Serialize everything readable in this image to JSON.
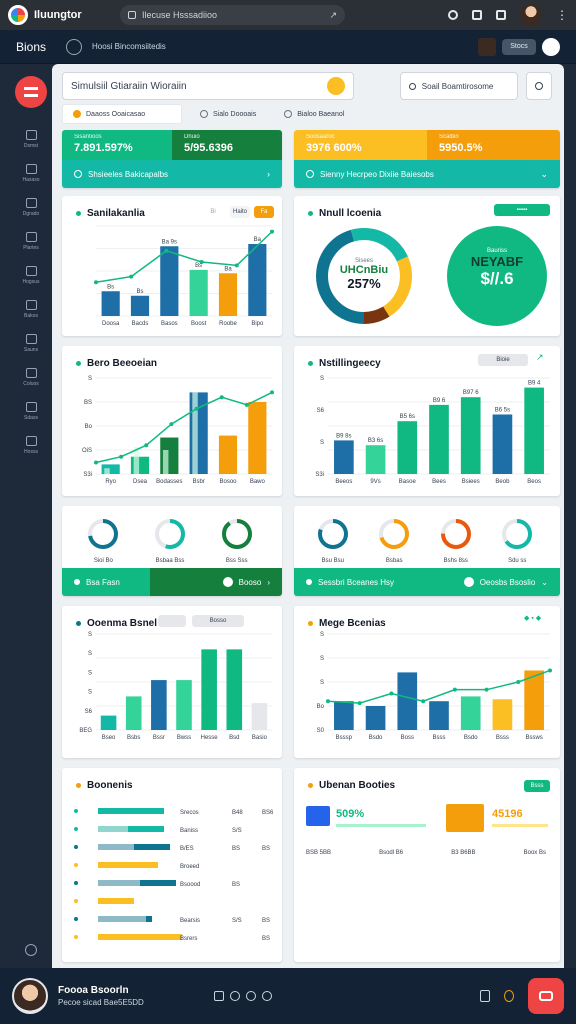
{
  "topbar": {
    "app_title": "Iluungtor",
    "url": "Ilecuse Hsssadiioo"
  },
  "navbar": {
    "title": "Bions",
    "crumb": "Hoosi Bincomsiitedis",
    "pill": "Stocs"
  },
  "sidebar": {
    "items": [
      {
        "label": "Dsmst",
        "icon": "chart-icon"
      },
      {
        "label": "Haxaso",
        "icon": "doc-icon"
      },
      {
        "label": "Dgrado",
        "icon": "folder-icon"
      },
      {
        "label": "Plartes",
        "icon": "calendar-icon"
      },
      {
        "label": "Hogsus",
        "icon": "image-icon"
      },
      {
        "label": "Bakos",
        "icon": "grid-icon"
      },
      {
        "label": "Sauns",
        "icon": "chat-icon"
      },
      {
        "label": "Coluos",
        "icon": "link-icon"
      },
      {
        "label": "Sdass",
        "icon": "globe-icon"
      },
      {
        "label": "Hosss",
        "icon": "settings-icon"
      }
    ]
  },
  "search": {
    "query": "Simulsiil Gtiaraiin Wioraiin",
    "secondary": "Soail Boamtirosome"
  },
  "tabs": [
    "Daaoss Ooaicasao",
    "Sialo Doooais",
    "Bialoo Baeanol"
  ],
  "kpi": [
    {
      "cells": [
        {
          "small": "Sisantioos",
          "big": "7.891.597%",
          "color": "#10b981"
        },
        {
          "small": "Dhuio",
          "big": "5/95.6396",
          "color": "#15803d"
        }
      ],
      "bottom": "Shsieeles Bakicapalbs",
      "bottom_color": "#14b8a6"
    },
    {
      "cells": [
        {
          "small": "Soosaaroc",
          "big": "3976 600%",
          "color": "#fbbf24"
        },
        {
          "small": "Scalbin",
          "big": "5950.5%",
          "color": "#f59e0b"
        }
      ],
      "bottom": "Sienny Hecrpeo Dixiie Baiesobs",
      "bottom_color": "#14b8a6"
    }
  ],
  "card1": {
    "title": "Sanilakanlia",
    "pills": [
      "Bi",
      "Haito",
      "Fa"
    ],
    "chart_data": {
      "type": "bar",
      "categories": [
        "Doosa",
        "Bacds",
        "Basos",
        "Boost",
        "Roobe",
        "Bipo"
      ],
      "values": [
        22,
        18,
        62,
        41,
        38,
        64
      ],
      "line": [
        30,
        35,
        58,
        48,
        45,
        75
      ],
      "ylim": [
        0,
        80
      ],
      "value_labels": [
        "Bs",
        "Bs",
        "Ba 9s",
        "Bs",
        "Ba",
        "Ba"
      ]
    }
  },
  "card2": {
    "title": "Nnull lcoenia",
    "donut": {
      "label": "Sisees",
      "big": "UHCnBiu",
      "sub": "257%"
    },
    "circle": {
      "label": "Bauriss",
      "big": "NEYABF",
      "sub": "$//.6"
    }
  },
  "card3": {
    "title": "Bero Beeoeian",
    "chart_data": {
      "type": "bar",
      "categories": [
        "Ryo",
        "Dsea",
        "Bodasses",
        "Bsbr",
        "Bosoo",
        "Bawo"
      ],
      "values": [
        10,
        18,
        38,
        85,
        40,
        75
      ],
      "values2": [
        6,
        28,
        25,
        85,
        0,
        0
      ],
      "line": [
        12,
        18,
        30,
        52,
        68,
        80,
        72,
        85
      ],
      "ylim": [
        0,
        100
      ],
      "yticks": [
        "S3i",
        "OiS",
        "Bo",
        "BS",
        "S"
      ]
    }
  },
  "card4": {
    "title": "Nstillingeecy",
    "pills": [
      "Bioie"
    ],
    "chart_data": {
      "type": "bar",
      "categories": [
        "Beeos",
        "9Vs",
        "Basoe",
        "Bees",
        "Bsiees",
        "Beob",
        "Beos"
      ],
      "values": [
        35,
        30,
        55,
        72,
        80,
        62,
        90
      ],
      "ylim": [
        0,
        100
      ],
      "yticks": [
        "S3i",
        "S",
        "S6",
        "S"
      ],
      "value_labels": [
        "B9 8s",
        "B3 6s",
        "B5 6s",
        "B9 6",
        "B97 6",
        "B6 5s",
        "B9 4"
      ]
    }
  },
  "gauges1": [
    {
      "value": 0.72,
      "label": "Sioi Bo",
      "color": "#0e7490"
    },
    {
      "value": 0.55,
      "label": "Bsbaa Bss",
      "color": "#14b8a6"
    },
    {
      "value": 0.9,
      "label": "Bss Sss",
      "color": "#15803d"
    }
  ],
  "gauges2": [
    {
      "value": 0.8,
      "label": "Bsu Bsu",
      "color": "#0e7490"
    },
    {
      "value": 0.7,
      "label": "Bsbas",
      "color": "#f59e0b"
    },
    {
      "value": 0.75,
      "label": "Bshs 8ss",
      "color": "#ea580c"
    },
    {
      "value": 0.65,
      "label": "Sdu ss",
      "color": "#14b8a6"
    }
  ],
  "strip1": {
    "left": "Bsa Fasn",
    "right": "Booso"
  },
  "strip2": {
    "left": "Sessbri Bceanes Hsy",
    "right": "Oeosbs Bsoslio"
  },
  "card5": {
    "title": "Ooenma Bsnel",
    "pills": [
      "",
      "Bosso"
    ],
    "chart_data": {
      "type": "bar",
      "categories": [
        "Bseo",
        "Bsbs",
        "Bssr",
        "Bwss",
        "Hesse",
        "Bsd",
        "Basio"
      ],
      "values": [
        15,
        35,
        52,
        52,
        84,
        84,
        28
      ],
      "ylim": [
        0,
        100
      ],
      "yticks": [
        "BEG",
        "S6",
        "S",
        "S",
        "S",
        "S"
      ]
    }
  },
  "card6": {
    "title": "Mege Bcenias",
    "chart_data": {
      "type": "bar",
      "categories": [
        "Bsssp",
        "Bsdo",
        "Boss",
        "Bsss",
        "Bsdo",
        "Bsss",
        "Bssws"
      ],
      "values": [
        30,
        25,
        60,
        30,
        35,
        32,
        62
      ],
      "line": [
        30,
        28,
        38,
        30,
        42,
        42,
        50,
        62
      ],
      "ylim": [
        0,
        100
      ],
      "yticks": [
        "S0",
        "Bo",
        "S",
        "S",
        "S"
      ]
    }
  },
  "card7": {
    "title": "Boonenis",
    "rows": [
      {
        "bar": 0.55,
        "bar2": 0,
        "color": "#14b8a6",
        "text": "Srecos",
        "v1": "B48",
        "v2": "BS6"
      },
      {
        "bar": 0.55,
        "bar2": 0.25,
        "color": "#14b8a6",
        "text": "Baniss",
        "v1": "S/S",
        "v2": ""
      },
      {
        "bar": 0.6,
        "bar2": 0.3,
        "color": "#0e7490",
        "text": "B/ES",
        "v1": "BS",
        "v2": "BS"
      },
      {
        "bar": 0.5,
        "bar2": 0,
        "color": "#fbbf24",
        "text": "Broeed",
        "v1": "",
        "v2": ""
      },
      {
        "bar": 0.65,
        "bar2": 0.35,
        "color": "#0e7490",
        "text": "Bsoood",
        "v1": "BS",
        "v2": ""
      },
      {
        "bar": 0.3,
        "bar2": 0,
        "color": "#fbbf24",
        "text": "",
        "v1": "",
        "v2": ""
      },
      {
        "bar": 0.45,
        "bar2": 0.4,
        "color": "#0e7490",
        "text": "Bearsis",
        "v1": "S/S",
        "v2": "BS"
      },
      {
        "bar": 0.7,
        "bar2": 0,
        "color": "#fbbf24",
        "text": "Bsrers",
        "v1": "",
        "v2": "BS"
      }
    ]
  },
  "card8": {
    "title": "Ubenan Booties",
    "pill": "Bsss",
    "items": [
      {
        "value": "509%",
        "sub": "",
        "color": "#10b981"
      },
      {
        "value": "45196",
        "sub": "",
        "color": "#f59e0b"
      }
    ],
    "footer": [
      "BSB 5BB",
      "Bsodl B6",
      "B3 B6BB",
      "Boox Bs"
    ]
  },
  "bottombar": {
    "name": "Foooa Bsoorln",
    "sub": "Pecoe sicad Bae5E5DD"
  }
}
